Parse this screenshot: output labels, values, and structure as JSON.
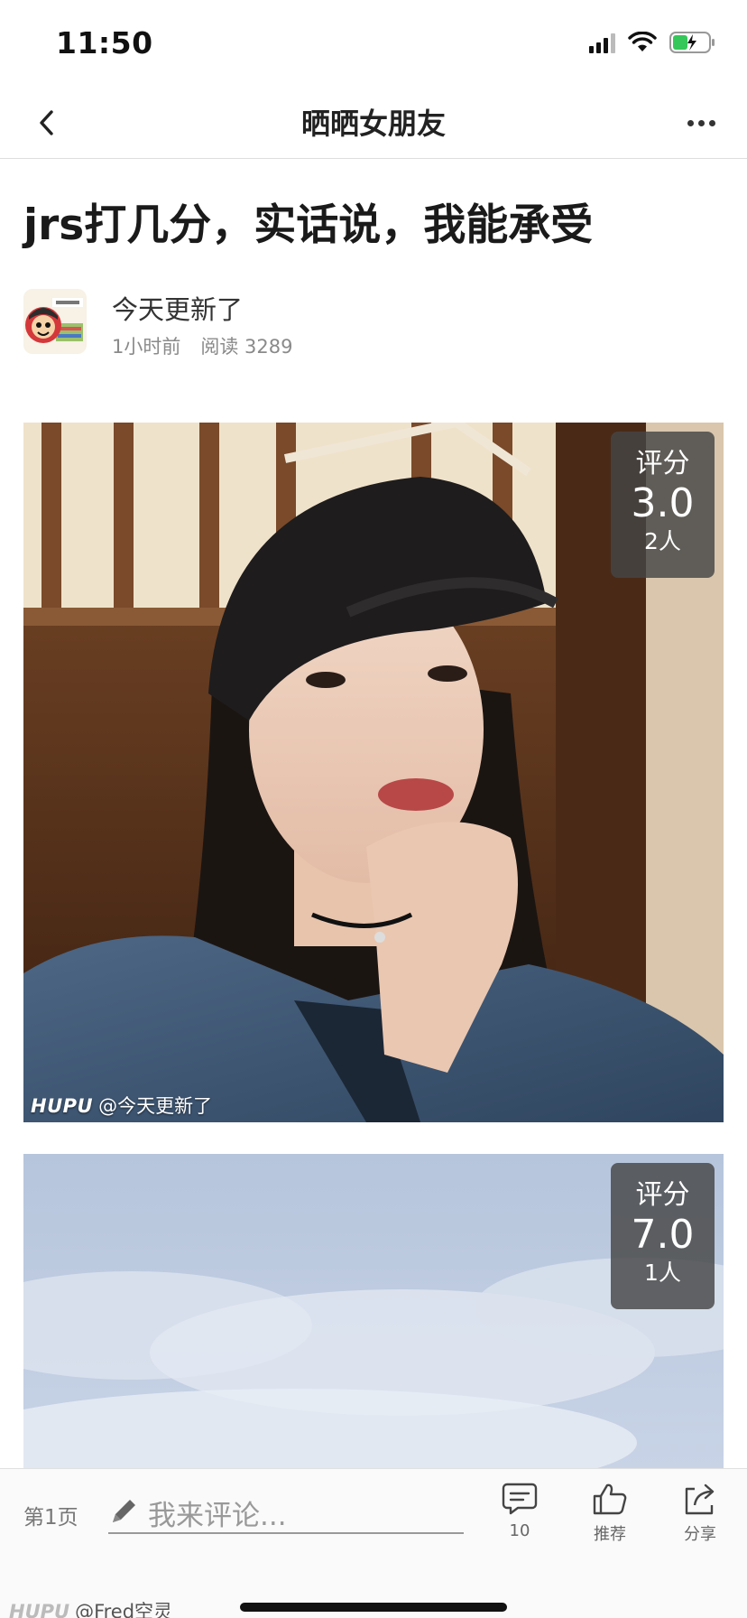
{
  "status_bar": {
    "time": "11:50"
  },
  "nav": {
    "title": "晒晒女朋友"
  },
  "post": {
    "title": "jrs打几分，实话说，我能承受",
    "author": "今天更新了",
    "time_ago": "1小时前",
    "reads_label": "阅读 3289"
  },
  "photos": [
    {
      "rating_label": "评分",
      "rating_score": "3.0",
      "rating_count": "2人",
      "watermark_brand": "HUPU",
      "watermark_user": "@今天更新了"
    },
    {
      "rating_label": "评分",
      "rating_score": "7.0",
      "rating_count": "1人"
    }
  ],
  "bottom_bar": {
    "page_label": "第1页",
    "comment_placeholder": "我来评论...",
    "comments_count": "10",
    "recommend_label": "推荐",
    "share_label": "分享"
  },
  "footer": {
    "watermark_brand": "HUPU",
    "watermark_user": "@Fred空灵"
  },
  "colors": {
    "badge_bg": "#464646",
    "text_primary": "#222222",
    "text_secondary": "#8a8a8a"
  },
  "icons": [
    "back-icon",
    "more-icon",
    "signal-icon",
    "wifi-icon",
    "battery-icon",
    "pencil-icon",
    "comment-icon",
    "thumbs-up-icon",
    "share-icon"
  ]
}
